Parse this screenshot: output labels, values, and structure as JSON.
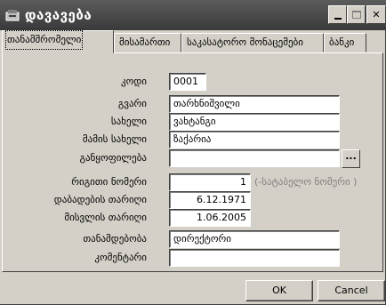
{
  "window": {
    "title": "დავავება",
    "minimize_glyph": "_",
    "close_glyph": "✕"
  },
  "tabs": [
    {
      "label": "თანამშრომელი",
      "active": true
    },
    {
      "label": "მისამართი",
      "active": false
    },
    {
      "label": "საკასატორო მონაცემები",
      "active": false
    },
    {
      "label": "ბანკი",
      "active": false
    }
  ],
  "form": {
    "code": {
      "label": "კოდი",
      "value": "0001"
    },
    "surname": {
      "label": "გვარი",
      "value": "თარხნიშვილი"
    },
    "name": {
      "label": "სახელი",
      "value": "ვახტანგი"
    },
    "father_name": {
      "label": "მამის სახელი",
      "value": "ზაქარია"
    },
    "department": {
      "label": "განყოფილება",
      "value": "",
      "browse_label": "..."
    },
    "order_number": {
      "label": "რიგითი ნომერი",
      "value": "1",
      "hint": "(-სატაბელო ნომერი )"
    },
    "birth_date": {
      "label": "დაბადების თარიღი",
      "value": "6.12.1971"
    },
    "hire_date": {
      "label": "მისვლის თარიღი",
      "value": "1.06.2005"
    },
    "position": {
      "label": "თანამდებობა",
      "value": "დირექტორი"
    },
    "comment": {
      "label": "კომენტარი",
      "value": ""
    }
  },
  "buttons": {
    "ok": "OK",
    "cancel": "Cancel"
  }
}
